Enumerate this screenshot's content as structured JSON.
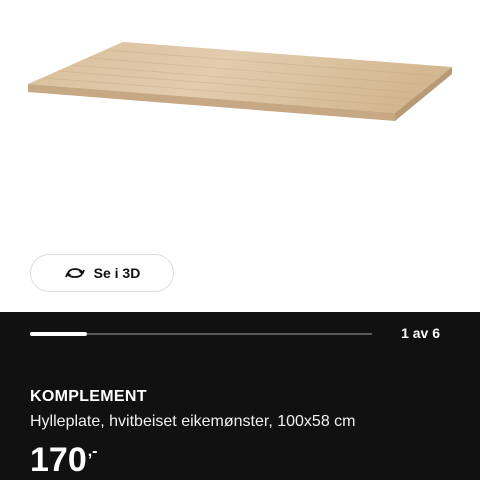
{
  "view3d": {
    "label": "Se i 3D",
    "icon": "rotate-3d-icon"
  },
  "carousel": {
    "counter": "1 av 6",
    "current": 1,
    "total": 6
  },
  "product": {
    "name": "KOMPLEMENT",
    "description": "Hylleplate, hvitbeiset eikemønster, 100x58 cm",
    "price": "170",
    "price_suffix": ",-"
  },
  "colors": {
    "panel_background": "#111111",
    "wood_top": "#dcc4a3",
    "wood_edge": "#c7aa86"
  }
}
